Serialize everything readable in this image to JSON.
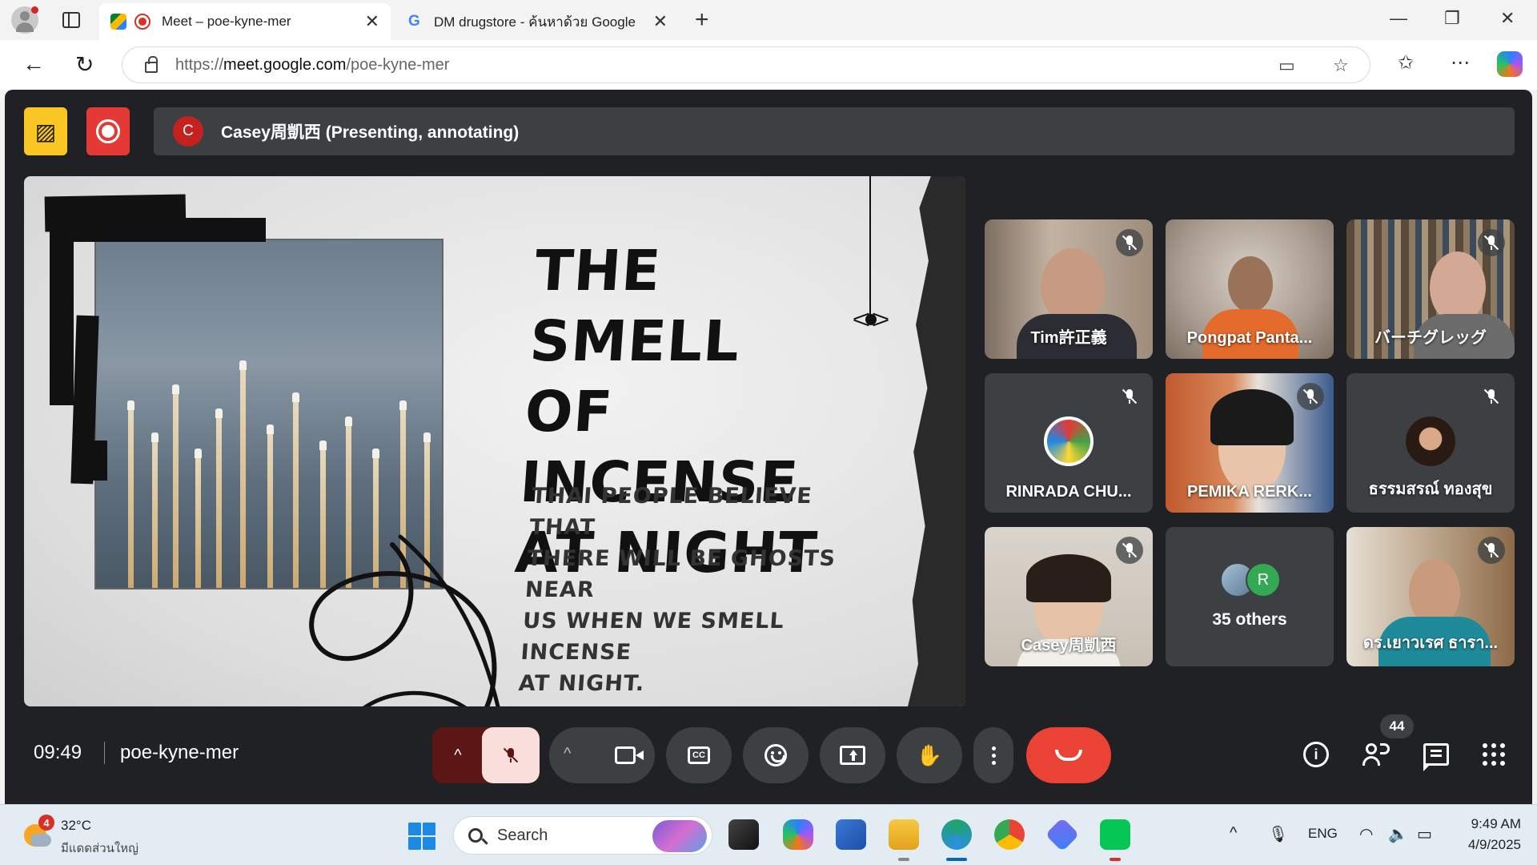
{
  "browser": {
    "tabs": [
      {
        "title": "Meet – poe-kyne-mer",
        "active": true
      },
      {
        "title": "DM drugstore - ค้นหาด้วย Google",
        "active": false
      }
    ],
    "tab_close_glyph": "✕",
    "new_tab_glyph": "+",
    "url_prefix": "https://",
    "url_host": "meet.google.com",
    "url_path": "/poe-kyne-mer",
    "window_controls": [
      "—",
      "❐",
      "✕"
    ],
    "nav_icons": {
      "back": "←",
      "reload": "↻"
    },
    "toolbar_icons": {
      "camera": "▭",
      "favorite": "☆",
      "favorites": "✩",
      "more": "⋯"
    }
  },
  "meet": {
    "presenter_initial": "C",
    "presenter_text": "Casey周凱西 (Presenting, annotating)",
    "yellow_badge_glyph": "▨",
    "slide": {
      "title": "THE SMELL\nOF INCENSE\nAT NIGHT",
      "body": "THAI PEOPLE BELIEVE THAT\nTHERE WILL BE GHOSTS NEAR\nUS WHEN WE SMELL INCENSE\nAT NIGHT."
    },
    "participants": [
      {
        "name": "Tim許正義",
        "muted": true
      },
      {
        "name": "Pongpat Panta...",
        "muted": false
      },
      {
        "name": "バーチグレッグ",
        "muted": true
      },
      {
        "name": "RINRADA CHU...",
        "muted": true
      },
      {
        "name": "PEMIKA RERK...",
        "muted": true
      },
      {
        "name": "ธรรมสรณ์ ทองสุข",
        "muted": true
      },
      {
        "name": "Casey周凱西",
        "muted": true
      },
      {
        "name": "ดร.เยาวเรศ ธารา...",
        "muted": true
      }
    ],
    "others": {
      "label": "35 others",
      "avatar_initial": "R"
    },
    "clock": "09:49",
    "meeting_code": "poe-kyne-mer",
    "people_count": "44",
    "control_glyphs": {
      "chevron_up": "^",
      "raise_hand": "✋",
      "info": "i",
      "cc": "CC"
    }
  },
  "taskbar": {
    "weather_badge": "4",
    "temperature": "32°C",
    "weather_desc": "มีแดดส่วนใหญ่",
    "search_label": "Search",
    "tray_language": "ENG",
    "tray_glyphs": {
      "overflow": "^",
      "mic": "🎙",
      "wifi": "◠",
      "volume": "🔈",
      "battery": "▭"
    },
    "time": "9:49 AM",
    "date": "4/9/2025"
  },
  "colors": {
    "meet_bg": "#202124",
    "tile_bg": "#3c4043",
    "end_call": "#ea4335",
    "mic_off_bg": "#f9dedc",
    "record_red": "#e53935",
    "badge_yellow": "#f9c623"
  }
}
